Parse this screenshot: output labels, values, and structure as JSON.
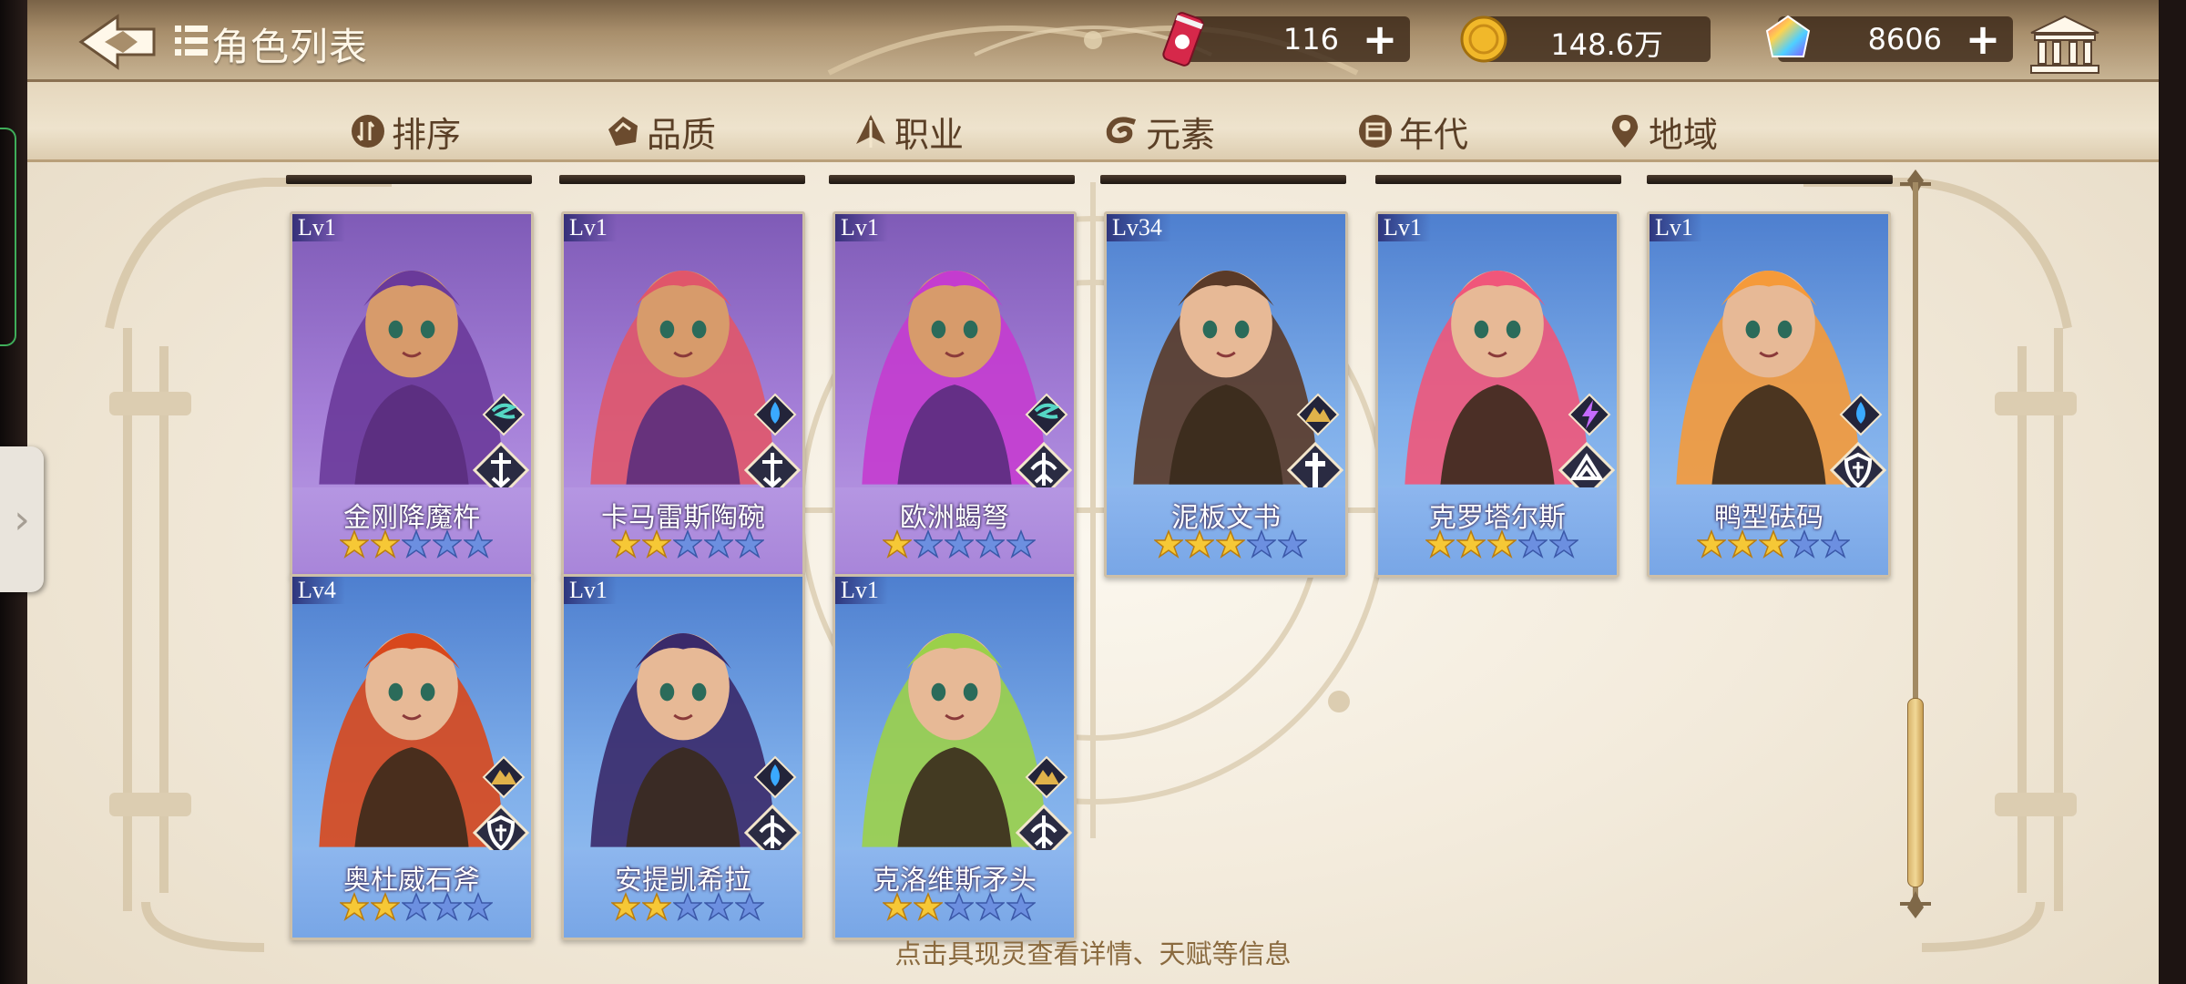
{
  "header": {
    "title": "角色列表",
    "back_icon": "back-arrow-icon",
    "list_icon": "list-icon"
  },
  "currencies": [
    {
      "name": "ticket",
      "icon": "soda-can-icon",
      "value": "116"
    },
    {
      "name": "gold",
      "icon": "gold-coin-icon",
      "value": "148.6万"
    },
    {
      "name": "gem",
      "icon": "rainbow-gem-icon",
      "value": "8606"
    }
  ],
  "bank_icon": "bank-building-icon",
  "filters": [
    {
      "label": "排序",
      "icon": "sort-icon"
    },
    {
      "label": "品质",
      "icon": "quality-icon"
    },
    {
      "label": "职业",
      "icon": "class-icon"
    },
    {
      "label": "元素",
      "icon": "element-icon"
    },
    {
      "label": "年代",
      "icon": "era-icon"
    },
    {
      "label": "地域",
      "icon": "location-pin-icon"
    }
  ],
  "characters": [
    {
      "level": "Lv1",
      "name": "金刚降魔杵",
      "stars": 2,
      "max_stars": 5,
      "rarity": "purple",
      "element": "wind",
      "class": "sword"
    },
    {
      "level": "Lv1",
      "name": "卡马雷斯陶碗",
      "stars": 2,
      "max_stars": 5,
      "rarity": "purple",
      "element": "water",
      "class": "sword"
    },
    {
      "level": "Lv1",
      "name": "欧洲蝎弩",
      "stars": 1,
      "max_stars": 5,
      "rarity": "purple",
      "element": "wind",
      "class": "archer"
    },
    {
      "level": "Lv34",
      "name": "泥板文书",
      "stars": 3,
      "max_stars": 5,
      "rarity": "blue",
      "element": "earth",
      "class": "healer"
    },
    {
      "level": "Lv1",
      "name": "克罗塔尔斯",
      "stars": 3,
      "max_stars": 5,
      "rarity": "blue",
      "element": "thunder",
      "class": "mage"
    },
    {
      "level": "Lv1",
      "name": "鸭型砝码",
      "stars": 3,
      "max_stars": 5,
      "rarity": "blue",
      "element": "water",
      "class": "shield"
    },
    {
      "level": "Lv4",
      "name": "奥杜威石斧",
      "stars": 2,
      "max_stars": 5,
      "rarity": "blue",
      "element": "earth",
      "class": "shield"
    },
    {
      "level": "Lv1",
      "name": "安提凯希拉",
      "stars": 2,
      "max_stars": 5,
      "rarity": "blue",
      "element": "water",
      "class": "archer"
    },
    {
      "level": "Lv1",
      "name": "克洛维斯矛头",
      "stars": 2,
      "max_stars": 5,
      "rarity": "blue",
      "element": "earth",
      "class": "archer"
    }
  ],
  "hint": "点击具现灵查看详情、天赋等信息",
  "colors": {
    "gold_text": "#8a6a3f",
    "tab_text": "#5a3f26",
    "purple_card": "#a57fd8",
    "blue_card": "#7eaeea",
    "star_on": "#f6c836",
    "star_off": "#6c8fe0"
  }
}
